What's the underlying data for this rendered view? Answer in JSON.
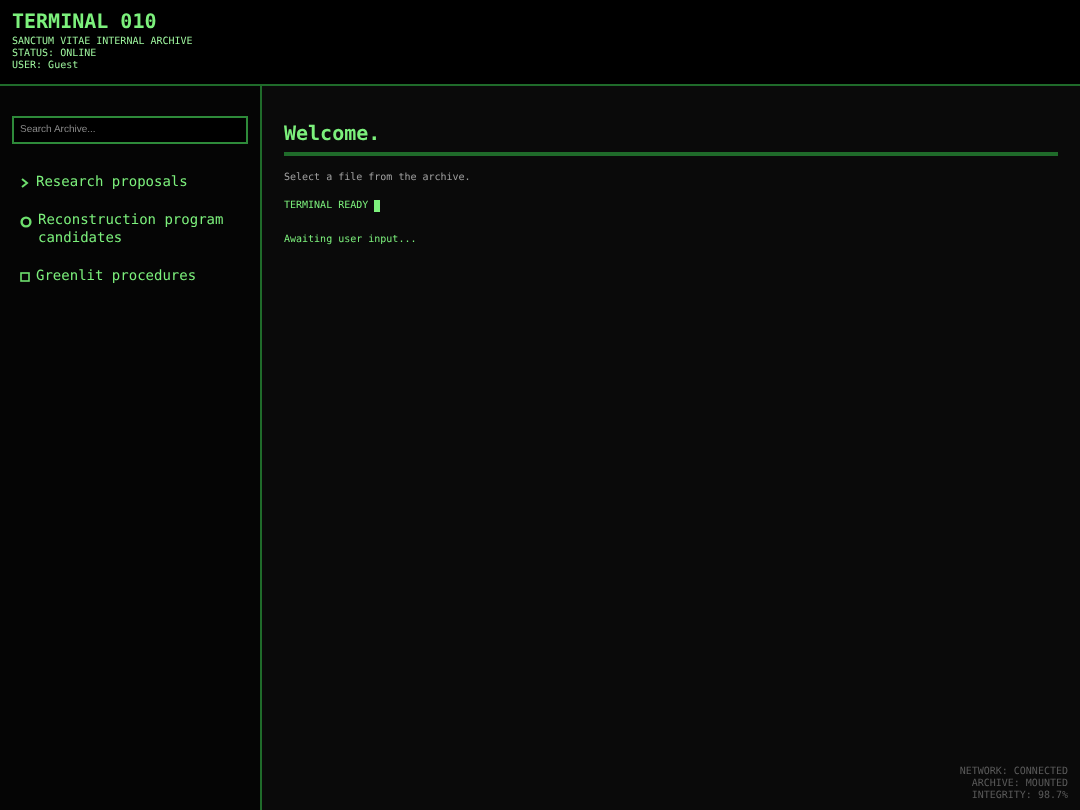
{
  "header": {
    "title": "TERMINAL 010",
    "lines": [
      "SANCTUM VITAE INTERNAL ARCHIVE",
      "STATUS: ONLINE",
      "USER: Guest"
    ]
  },
  "search": {
    "placeholder": "Search Archive..."
  },
  "sidebar": {
    "items": [
      {
        "label": "Research proposals",
        "kind": "chevron"
      },
      {
        "label": "Reconstruction program candidates",
        "kind": "circle"
      },
      {
        "label": "Greenlit procedures",
        "kind": "check"
      }
    ]
  },
  "main": {
    "heading": "Welcome.",
    "intro": "Select a file from the archive.",
    "ready": "TERMINAL READY",
    "awaiting": "Awaiting user input..."
  },
  "status": [
    "NETWORK: CONNECTED",
    "ARCHIVE: MOUNTED",
    "INTEGRITY: 98.7%"
  ]
}
